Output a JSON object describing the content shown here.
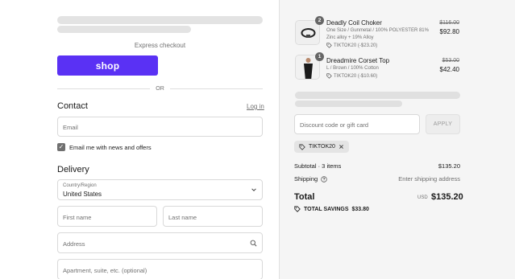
{
  "checkout": {
    "express_label": "Express checkout",
    "shop_button": "shop",
    "or_label": "OR",
    "contact": {
      "heading": "Contact",
      "login_link": "Log in",
      "email_placeholder": "Email",
      "newsletter_label": "Email me with news and offers",
      "newsletter_checked": true
    },
    "delivery": {
      "heading": "Delivery",
      "country_label": "Country/Region",
      "country_value": "United States",
      "first_name_placeholder": "First name",
      "last_name_placeholder": "Last name",
      "address_placeholder": "Address",
      "apartment_placeholder": "Apartment, suite, etc. (optional)"
    }
  },
  "summary": {
    "items": [
      {
        "name": "Deadly Coil Choker",
        "variant_line1": "One Size / Gunmetal / 100% POLYESTER 81%",
        "variant_line2": "Zinc alloy + 19% Alloy",
        "discount": "TIKTOK20 (-$23.20)",
        "qty": "2",
        "original_price": "$116.00",
        "price": "$92.80"
      },
      {
        "name": "Dreadmire Corset Top",
        "variant_line1": "L / Brown / 100% Cotton",
        "variant_line2": "",
        "discount": "TIKTOK20 (-$10.60)",
        "qty": "1",
        "original_price": "$53.00",
        "price": "$42.40"
      }
    ],
    "discount_placeholder": "Discount code or gift card",
    "apply_label": "APPLY",
    "applied_code": "TIKTOK20",
    "subtotal_label": "Subtotal · 3 items",
    "subtotal_value": "$135.20",
    "shipping_label": "Shipping",
    "shipping_value": "Enter shipping address",
    "total_label": "Total",
    "currency": "USD",
    "total_value": "$135.20",
    "savings_label": "TOTAL SAVINGS",
    "savings_value": "$33.80"
  },
  "colors": {
    "shop_purple": "#5a31f4",
    "sidebar_bg": "#f5f5f5",
    "skeleton": "#e3e3e3"
  }
}
